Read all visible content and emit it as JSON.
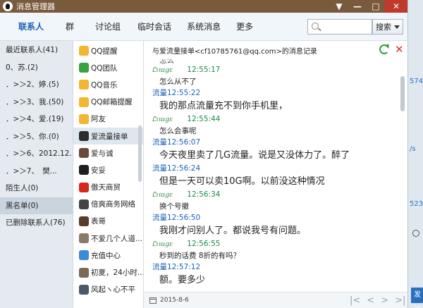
{
  "window": {
    "title": "消息管理器",
    "controls": [
      "▼",
      "—",
      "□",
      "✕"
    ]
  },
  "toolbar": {
    "tabs": [
      {
        "label": "联系人",
        "active": true
      },
      {
        "label": "群",
        "active": false
      },
      {
        "label": "讨论组",
        "active": false
      },
      {
        "label": "临时会话",
        "active": false
      },
      {
        "label": "系统消息",
        "active": false
      },
      {
        "label": "更多",
        "active": false
      }
    ],
    "search_placeholder": "",
    "search_button": "搜索"
  },
  "leftnav": {
    "items": [
      "最近联系人(41)",
      "0、苏.(2)",
      "．>＞2、婷.(5)",
      "．>＞3、我.(50)",
      "．>＞4、爱.(19)",
      "．>＞5、你.(0)",
      "．>＞6、2012.12....",
      "．>＞7、　樊...",
      "陌生人(0)",
      "黑名单(0)",
      "已删除联系人(76)"
    ],
    "selected_index": 9
  },
  "contacts": {
    "items": [
      {
        "name": "QQ提醒",
        "icon": "qq-penguin-icon",
        "color": "#f2b630"
      },
      {
        "name": "QQ团队",
        "icon": "qq-team-icon",
        "color": "#3aa241"
      },
      {
        "name": "QQ音乐",
        "icon": "qq-music-icon",
        "color": "#f2b630"
      },
      {
        "name": "QQ邮箱提醒",
        "icon": "qq-mail-icon",
        "color": "#f2b630"
      },
      {
        "name": "阿友",
        "icon": "avatar-icon",
        "color": "#f2b630"
      },
      {
        "name": "爱流量接单",
        "icon": "avatar-icon",
        "color": "#2d2d2d"
      },
      {
        "name": "爱与诚",
        "icon": "avatar-icon",
        "color": "#6b4a3a"
      },
      {
        "name": "安妥",
        "icon": "avatar-icon",
        "color": "#1e1e1e"
      },
      {
        "name": "傲天商贸",
        "icon": "avatar-icon",
        "color": "#d7281e"
      },
      {
        "name": "倍爽商务网络",
        "icon": "avatar-icon",
        "color": "#444444"
      },
      {
        "name": "表哥",
        "icon": "avatar-icon",
        "color": "#5a3b2a"
      },
      {
        "name": "不爱几个人道...",
        "icon": "avatar-icon",
        "color": "#8a7a6a"
      },
      {
        "name": "充值中心",
        "icon": "avatar-icon",
        "color": "#3a8ad8"
      },
      {
        "name": "初夏，24小时...",
        "icon": "avatar-icon",
        "color": "#7a6a5a"
      },
      {
        "name": "风起ヽ心不平",
        "icon": "avatar-icon",
        "color": "#4a5a6a"
      }
    ],
    "selected_index": 5
  },
  "conversation": {
    "header": "与爱流量接单<cf10785761@qq.com>的消息记录",
    "partial_top": "怎么",
    "messages": [
      {
        "sender": "",
        "sender_is_image": true,
        "time": "12:55:17",
        "text": "怎么从不了",
        "size": "small"
      },
      {
        "sender": "流量",
        "sender_is_image": false,
        "time": "12:55:22",
        "text": "我的那点流量充不到你手机里，",
        "size": "big"
      },
      {
        "sender": "",
        "sender_is_image": true,
        "time": "12:55:44",
        "text": "怎么会事呢",
        "size": "small"
      },
      {
        "sender": "流量",
        "sender_is_image": false,
        "time": "12:56:07",
        "text": "今天夜里卖了几G流量。说是又没体力了。醉了",
        "size": "big"
      },
      {
        "sender": "流量",
        "sender_is_image": false,
        "time": "12:56:24",
        "text": "但是一天可以卖10G啊。以前没这种情况",
        "size": "big"
      },
      {
        "sender": "",
        "sender_is_image": true,
        "time": "12:56:34",
        "text": "换个号撤",
        "size": "small"
      },
      {
        "sender": "流量",
        "sender_is_image": false,
        "time": "12:56:50",
        "text": "我刚才问别人了。都说我号有问题。",
        "size": "big"
      },
      {
        "sender": "",
        "sender_is_image": true,
        "time": "12:56:55",
        "text": "秒到的话费 8折的有吗？",
        "size": "small"
      },
      {
        "sender": "流量",
        "sender_is_image": false,
        "time": "12:57:12",
        "text": "额。要多少",
        "size": "big"
      }
    ],
    "footer_date": "2015-8-6",
    "pager": [
      "|<",
      "<",
      ">",
      ">|"
    ]
  },
  "background_window": {
    "texts": [
      "574",
      "/s",
      "523"
    ],
    "send_button": "发送"
  }
}
